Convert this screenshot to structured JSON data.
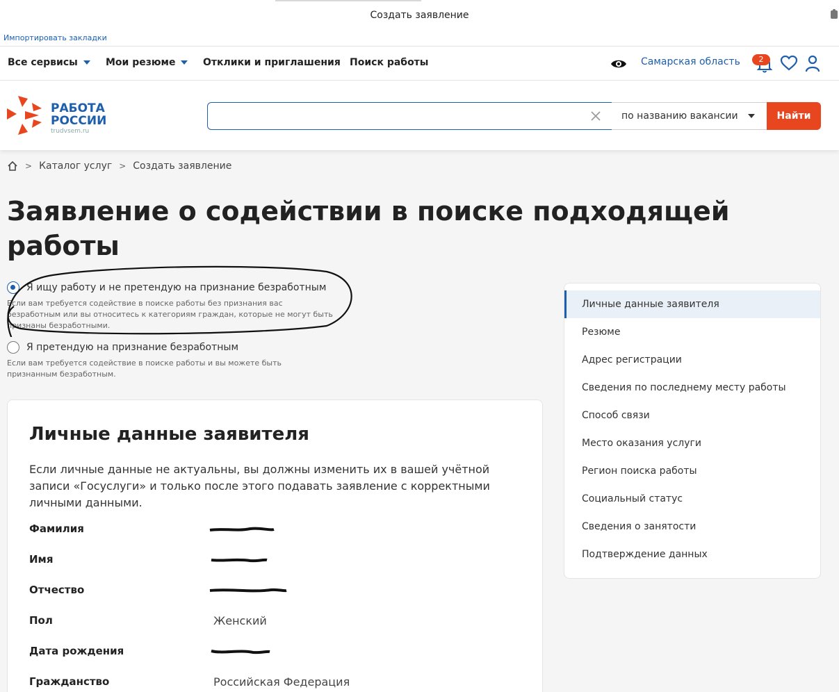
{
  "browser": {
    "window_title": "Создать заявление",
    "bookmark_label": "Импортировать закладки"
  },
  "topnav": {
    "items": [
      {
        "label": "Все сервисы",
        "has_dropdown": true
      },
      {
        "label": "Мои резюме",
        "has_dropdown": true
      },
      {
        "label": "Отклики и приглашения",
        "has_dropdown": false
      },
      {
        "label": "Поиск работы",
        "has_dropdown": false
      }
    ],
    "region": "Самарская область",
    "notifications_count": "2",
    "icons": [
      "eye-icon",
      "bell-icon",
      "heart-icon",
      "user-icon"
    ]
  },
  "header": {
    "logo_line1": "РАБОТА",
    "logo_line2": "РОССИИ",
    "logo_domain": "trudvsem.ru",
    "search_value": "",
    "search_placeholder": "",
    "search_type": "по названию вакансии",
    "find_label": "Найти"
  },
  "breadcrumb": {
    "items": [
      "Каталог услуг",
      "Создать заявление"
    ]
  },
  "page": {
    "title": "Заявление о содействии в поиске подходящей работы"
  },
  "options": [
    {
      "label": "Я ищу работу и не претендую на признание безработным",
      "hint": "Если вам требуется содействие в поиске работы без признания вас безработным или вы относитесь к категориям граждан, которые не могут быть признаны безработными.",
      "selected": true
    },
    {
      "label": "Я претендую на признание безработным",
      "hint": "Если вам требуется содействие в поиске работы и вы можете быть признанным безработным.",
      "selected": false
    }
  ],
  "personal": {
    "title": "Личные данные заявителя",
    "note": "Если личные данные не актуальны, вы должны изменить их в вашей учётной записи «Госуслуги» и только после этого подавать заявление с корректными личными данными.",
    "fields": [
      {
        "label": "Фамилия",
        "value": "",
        "redacted": true
      },
      {
        "label": "Имя",
        "value": "",
        "redacted": true
      },
      {
        "label": "Отчество",
        "value": "",
        "redacted": true
      },
      {
        "label": "Пол",
        "value": "Женский",
        "redacted": false
      },
      {
        "label": "Дата рождения",
        "value": "",
        "redacted": true
      },
      {
        "label": "Гражданство",
        "value": "Российская Федерация",
        "redacted": false
      }
    ]
  },
  "sidenav": {
    "items": [
      "Личные данные заявителя",
      "Резюме",
      "Адрес регистрации",
      "Сведения по последнему месту работы",
      "Способ связи",
      "Место оказания услуги",
      "Регион поиска работы",
      "Социальный статус",
      "Сведения о занятости",
      "Подтверждение данных"
    ],
    "active_index": 0
  },
  "colors": {
    "brand_blue": "#1d5fad",
    "accent_orange": "#e8461f",
    "page_bg": "#f5f5f5"
  }
}
